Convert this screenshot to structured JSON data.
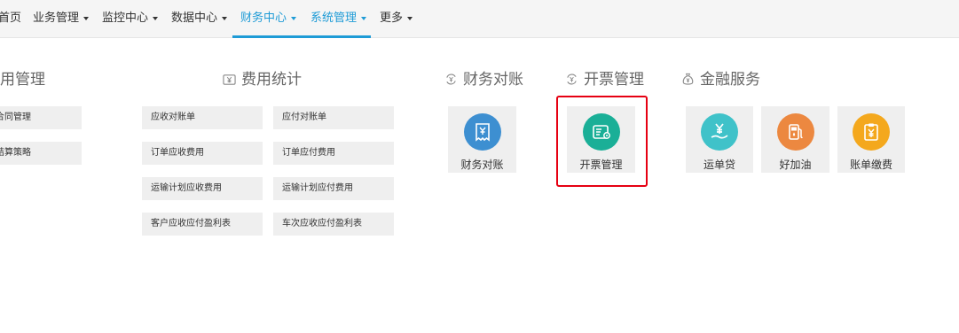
{
  "nav": {
    "items": [
      {
        "label": "首页",
        "caret": false
      },
      {
        "label": "业务管理",
        "caret": true
      },
      {
        "label": "监控中心",
        "caret": true
      },
      {
        "label": "数据中心",
        "caret": true
      },
      {
        "label": "财务中心",
        "caret": true
      },
      {
        "label": "系统管理",
        "caret": true
      },
      {
        "label": "更多",
        "caret": true
      }
    ],
    "active_color": "#1e9bd6"
  },
  "sections": {
    "fee_management": {
      "title": "费用管理",
      "items": [
        "合同管理",
        "结算策略"
      ]
    },
    "fee_statistics": {
      "title": "费用统计",
      "icon": "yen-doc-icon",
      "left_items": [
        "应收对账单",
        "订单应收费用",
        "运输计划应收费用",
        "客户应收应付盈利表"
      ],
      "right_items": [
        "应付对账单",
        "订单应付费用",
        "运输计划应付费用",
        "车次应收应付盈利表"
      ]
    },
    "reconciliation": {
      "title": "财务对账",
      "icon": "yen-cycle-icon",
      "tiles": [
        {
          "label": "财务对账",
          "icon": "receipt-icon",
          "color": "#3d8fd1"
        }
      ]
    },
    "invoicing": {
      "title": "开票管理",
      "icon": "yen-cycle-icon",
      "tiles": [
        {
          "label": "开票管理",
          "icon": "invoice-settings-icon",
          "color": "#1aaf97"
        }
      ]
    },
    "finance": {
      "title": "金融服务",
      "icon": "money-bag-icon",
      "tiles": [
        {
          "label": "运单贷",
          "icon": "yen-hand-icon",
          "color": "#3fc2c9"
        },
        {
          "label": "好加油",
          "icon": "fuel-pump-icon",
          "color": "#ec8840"
        },
        {
          "label": "账单缴费",
          "icon": "clipboard-yen-icon",
          "color": "#f4a81d"
        }
      ]
    }
  },
  "highlight_color": "#e60012"
}
